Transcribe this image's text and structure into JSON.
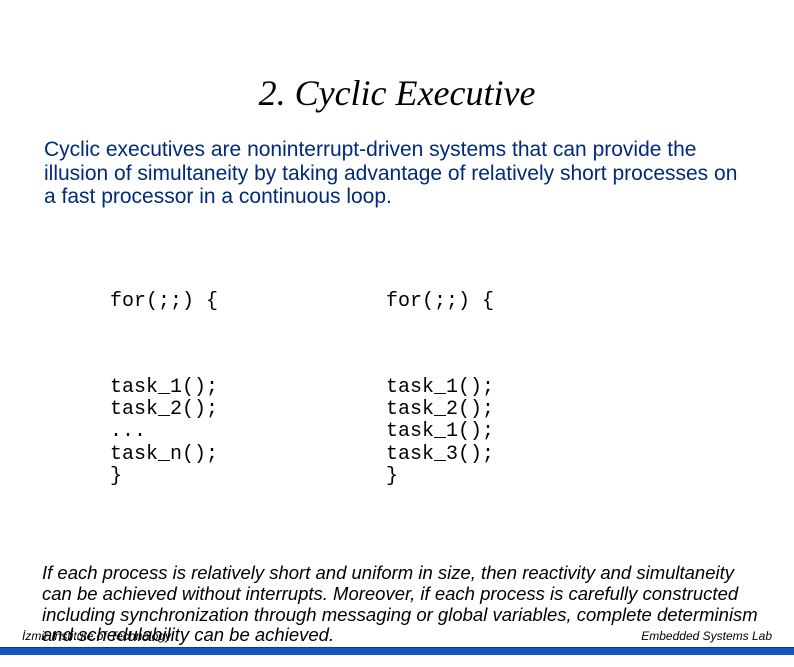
{
  "title": "2. Cyclic Executive",
  "intro": "Cyclic executives are noninterrupt-driven systems that can provide the illusion of simultaneity by taking advantage of relatively short processes on a fast processor in a continuous loop.",
  "code_left": {
    "for": "for(;;) {",
    "body": "task_1();\ntask_2();\n...\ntask_n();\n}"
  },
  "code_right": {
    "for": "for(;;) {",
    "body": "task_1();\ntask_2();\ntask_1();\ntask_3();\n}"
  },
  "outro": "If each process is relatively short and uniform in size, then reactivity and simultaneity can be achieved without interrupts. Moreover, if each process is carefully constructed including synchronization through messaging or global variables, complete determinism and schedulability can be achieved.",
  "footer": {
    "left": "İzmir Institute of Technology",
    "right": "Embedded Systems Lab"
  }
}
